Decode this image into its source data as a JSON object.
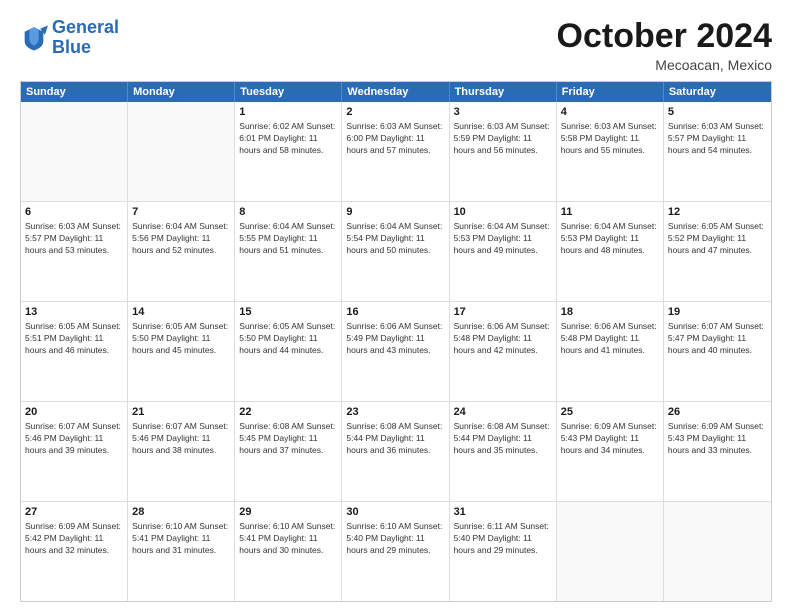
{
  "logo": {
    "line1": "General",
    "line2": "Blue"
  },
  "header": {
    "month": "October 2024",
    "location": "Mecoacan, Mexico"
  },
  "days": [
    "Sunday",
    "Monday",
    "Tuesday",
    "Wednesday",
    "Thursday",
    "Friday",
    "Saturday"
  ],
  "weeks": [
    [
      {
        "day": "",
        "info": ""
      },
      {
        "day": "",
        "info": ""
      },
      {
        "day": "1",
        "info": "Sunrise: 6:02 AM\nSunset: 6:01 PM\nDaylight: 11 hours and 58 minutes."
      },
      {
        "day": "2",
        "info": "Sunrise: 6:03 AM\nSunset: 6:00 PM\nDaylight: 11 hours and 57 minutes."
      },
      {
        "day": "3",
        "info": "Sunrise: 6:03 AM\nSunset: 5:59 PM\nDaylight: 11 hours and 56 minutes."
      },
      {
        "day": "4",
        "info": "Sunrise: 6:03 AM\nSunset: 5:58 PM\nDaylight: 11 hours and 55 minutes."
      },
      {
        "day": "5",
        "info": "Sunrise: 6:03 AM\nSunset: 5:57 PM\nDaylight: 11 hours and 54 minutes."
      }
    ],
    [
      {
        "day": "6",
        "info": "Sunrise: 6:03 AM\nSunset: 5:57 PM\nDaylight: 11 hours and 53 minutes."
      },
      {
        "day": "7",
        "info": "Sunrise: 6:04 AM\nSunset: 5:56 PM\nDaylight: 11 hours and 52 minutes."
      },
      {
        "day": "8",
        "info": "Sunrise: 6:04 AM\nSunset: 5:55 PM\nDaylight: 11 hours and 51 minutes."
      },
      {
        "day": "9",
        "info": "Sunrise: 6:04 AM\nSunset: 5:54 PM\nDaylight: 11 hours and 50 minutes."
      },
      {
        "day": "10",
        "info": "Sunrise: 6:04 AM\nSunset: 5:53 PM\nDaylight: 11 hours and 49 minutes."
      },
      {
        "day": "11",
        "info": "Sunrise: 6:04 AM\nSunset: 5:53 PM\nDaylight: 11 hours and 48 minutes."
      },
      {
        "day": "12",
        "info": "Sunrise: 6:05 AM\nSunset: 5:52 PM\nDaylight: 11 hours and 47 minutes."
      }
    ],
    [
      {
        "day": "13",
        "info": "Sunrise: 6:05 AM\nSunset: 5:51 PM\nDaylight: 11 hours and 46 minutes."
      },
      {
        "day": "14",
        "info": "Sunrise: 6:05 AM\nSunset: 5:50 PM\nDaylight: 11 hours and 45 minutes."
      },
      {
        "day": "15",
        "info": "Sunrise: 6:05 AM\nSunset: 5:50 PM\nDaylight: 11 hours and 44 minutes."
      },
      {
        "day": "16",
        "info": "Sunrise: 6:06 AM\nSunset: 5:49 PM\nDaylight: 11 hours and 43 minutes."
      },
      {
        "day": "17",
        "info": "Sunrise: 6:06 AM\nSunset: 5:48 PM\nDaylight: 11 hours and 42 minutes."
      },
      {
        "day": "18",
        "info": "Sunrise: 6:06 AM\nSunset: 5:48 PM\nDaylight: 11 hours and 41 minutes."
      },
      {
        "day": "19",
        "info": "Sunrise: 6:07 AM\nSunset: 5:47 PM\nDaylight: 11 hours and 40 minutes."
      }
    ],
    [
      {
        "day": "20",
        "info": "Sunrise: 6:07 AM\nSunset: 5:46 PM\nDaylight: 11 hours and 39 minutes."
      },
      {
        "day": "21",
        "info": "Sunrise: 6:07 AM\nSunset: 5:46 PM\nDaylight: 11 hours and 38 minutes."
      },
      {
        "day": "22",
        "info": "Sunrise: 6:08 AM\nSunset: 5:45 PM\nDaylight: 11 hours and 37 minutes."
      },
      {
        "day": "23",
        "info": "Sunrise: 6:08 AM\nSunset: 5:44 PM\nDaylight: 11 hours and 36 minutes."
      },
      {
        "day": "24",
        "info": "Sunrise: 6:08 AM\nSunset: 5:44 PM\nDaylight: 11 hours and 35 minutes."
      },
      {
        "day": "25",
        "info": "Sunrise: 6:09 AM\nSunset: 5:43 PM\nDaylight: 11 hours and 34 minutes."
      },
      {
        "day": "26",
        "info": "Sunrise: 6:09 AM\nSunset: 5:43 PM\nDaylight: 11 hours and 33 minutes."
      }
    ],
    [
      {
        "day": "27",
        "info": "Sunrise: 6:09 AM\nSunset: 5:42 PM\nDaylight: 11 hours and 32 minutes."
      },
      {
        "day": "28",
        "info": "Sunrise: 6:10 AM\nSunset: 5:41 PM\nDaylight: 11 hours and 31 minutes."
      },
      {
        "day": "29",
        "info": "Sunrise: 6:10 AM\nSunset: 5:41 PM\nDaylight: 11 hours and 30 minutes."
      },
      {
        "day": "30",
        "info": "Sunrise: 6:10 AM\nSunset: 5:40 PM\nDaylight: 11 hours and 29 minutes."
      },
      {
        "day": "31",
        "info": "Sunrise: 6:11 AM\nSunset: 5:40 PM\nDaylight: 11 hours and 29 minutes."
      },
      {
        "day": "",
        "info": ""
      },
      {
        "day": "",
        "info": ""
      }
    ]
  ]
}
